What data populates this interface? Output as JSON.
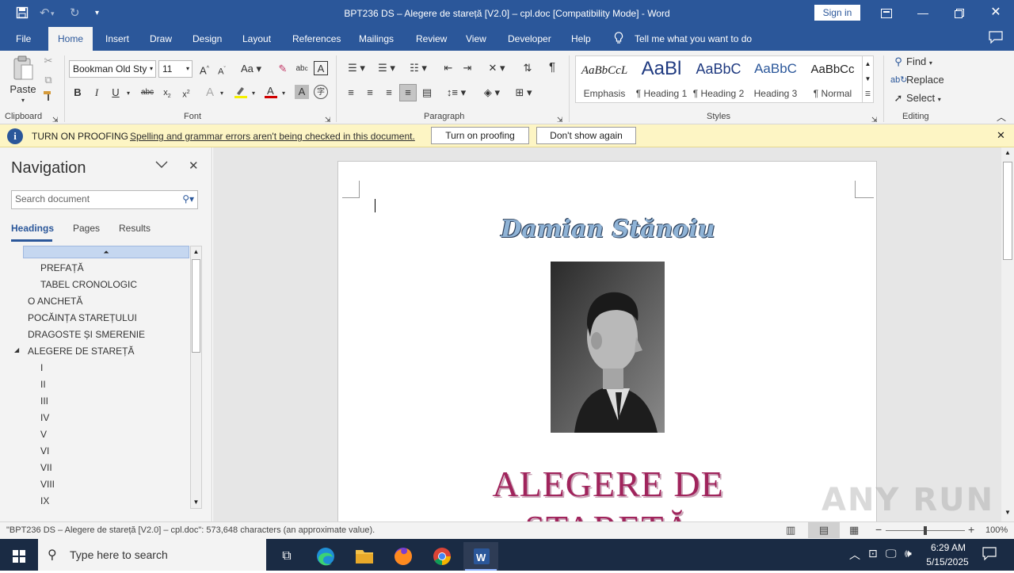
{
  "window": {
    "title": "BPT236 DS – Alegere de stareță [V2.0] – cpl.doc [Compatibility Mode]  -  Word",
    "sign_in": "Sign in"
  },
  "tabs": [
    "File",
    "Home",
    "Insert",
    "Draw",
    "Design",
    "Layout",
    "References",
    "Mailings",
    "Review",
    "View",
    "Developer",
    "Help"
  ],
  "tell_me": "Tell me what you want to do",
  "ribbon": {
    "paste": "Paste",
    "clipboard": "Clipboard",
    "font_name": "Bookman Old Sty",
    "font_size": "11",
    "font": "Font",
    "paragraph": "Paragraph",
    "styles": "Styles",
    "editing": "Editing",
    "style_items": [
      {
        "preview": "AaBbCcL",
        "name": "Emphasis"
      },
      {
        "preview": "AaBl",
        "name": "¶ Heading 1"
      },
      {
        "preview": "AaBbC",
        "name": "¶ Heading 2"
      },
      {
        "preview": "AaBbC",
        "name": "Heading 3"
      },
      {
        "preview": "AaBbCc",
        "name": "¶ Normal"
      }
    ],
    "find": "Find",
    "replace": "Replace",
    "select": "Select"
  },
  "infobar": {
    "title": "TURN ON PROOFING",
    "message": "Spelling and grammar errors aren't being checked in this document.",
    "turn_on": "Turn on proofing",
    "dont_show": "Don't show again"
  },
  "nav": {
    "title": "Navigation",
    "search_placeholder": "Search document",
    "tabs": [
      "Headings",
      "Pages",
      "Results"
    ],
    "items": [
      "PREFAȚĂ",
      "TABEL CRONOLOGIC",
      "O ANCHETĂ",
      "POCĂINȚA STAREȚULUI",
      "DRAGOSTE ȘI SMERENIE",
      "ALEGERE DE STAREȚĂ",
      "I",
      "II",
      "III",
      "IV",
      "V",
      "VI",
      "VII",
      "VIII",
      "IX"
    ]
  },
  "doc": {
    "author": "Damian Stănoiu",
    "title_line1": "ALEGERE DE",
    "title_line2": "STAREȚĂ"
  },
  "status": {
    "text": "\"BPT236 DS – Alegere de stareță [V2.0] – cpl.doc\": 573,648 characters (an approximate value).",
    "zoom": "100%"
  },
  "watermark": "ANY RUN",
  "taskbar": {
    "search": "Type here to search",
    "time": "6:29 AM",
    "date": "5/15/2025"
  },
  "colors": {
    "word_blue": "#2b579a",
    "title_red": "#a0245c",
    "infobar": "#fdf5c4"
  }
}
